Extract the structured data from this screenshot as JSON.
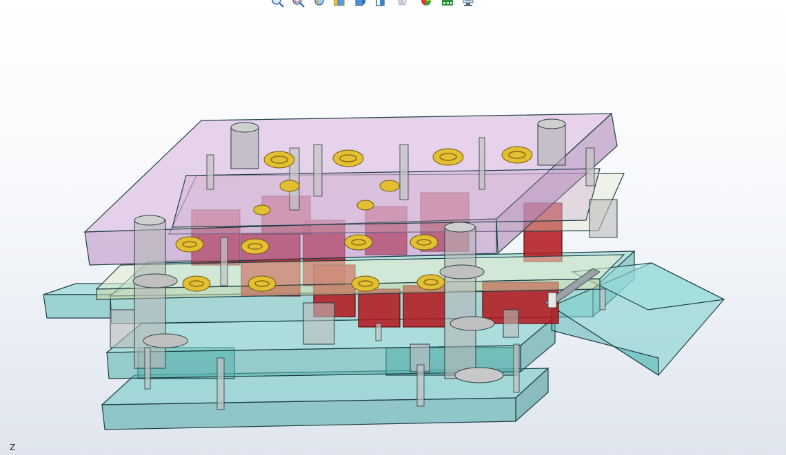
{
  "toolbar": {
    "buttons": [
      {
        "icon": "zoom-to-fit-icon"
      },
      {
        "icon": "zoom-to-area-icon"
      },
      {
        "icon": "previous-view-icon"
      },
      {
        "icon": "section-view-icon"
      },
      {
        "icon": "view-orientation-icon"
      },
      {
        "icon": "display-style-icon"
      },
      {
        "icon": "hide-show-items-icon"
      },
      {
        "icon": "edit-appearance-icon"
      },
      {
        "icon": "apply-scene-icon"
      },
      {
        "icon": "view-settings-icon"
      }
    ]
  },
  "viewport": {
    "triad_axis_label": "Z"
  },
  "colors": {
    "top_plate": "#c89ad0",
    "base_plates": "#5fbdba",
    "inserts": "#b3151b",
    "springs": "#d8b227",
    "guide_posts": "#b8b8b8",
    "stripper": "#dde6c0"
  }
}
